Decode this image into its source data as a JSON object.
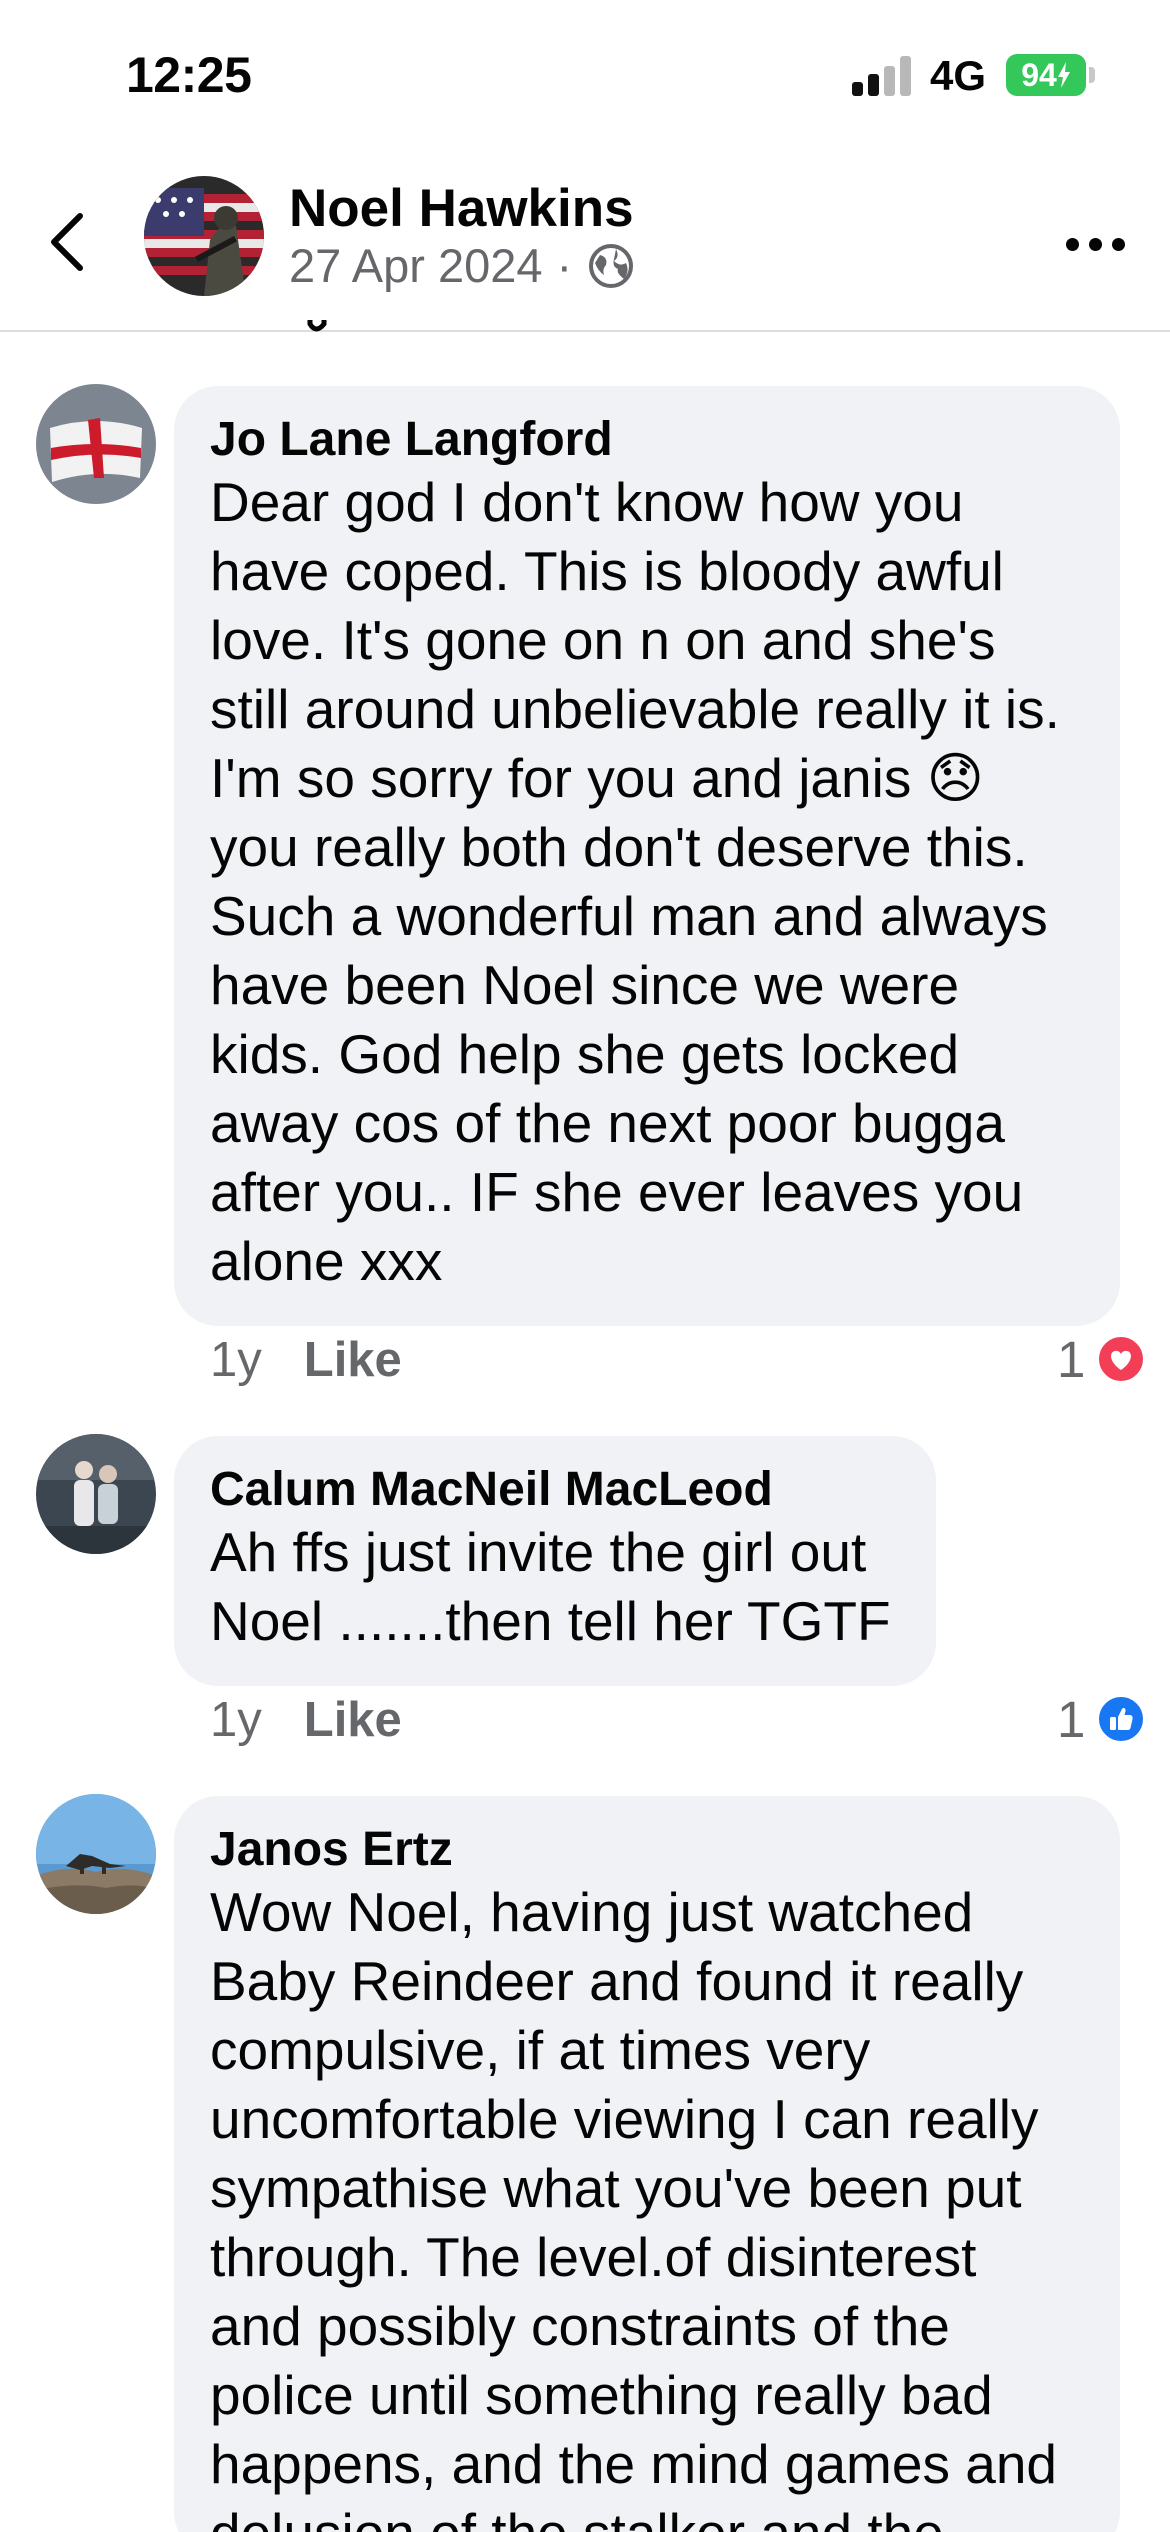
{
  "status_bar": {
    "time": "12:25",
    "network": "4G",
    "battery": "94",
    "battery_color": "#34c759"
  },
  "post_header": {
    "author": "Noel Hawkins",
    "date": "27 Apr 2024",
    "separator": "·",
    "back_icon": "chevron-left-icon",
    "privacy_icon": "globe-icon",
    "more_icon": "more-horizontal-icon"
  },
  "comments": [
    {
      "name": "Jo Lane Langford",
      "lines": [
        "Dear god I don't know how you",
        "have coped. This is bloody awful",
        "love. It's gone on n on and she's",
        "still around unbelievable really it is.",
        "I'm so sorry for you and janis 😞",
        "you really both don't deserve this.",
        "Such a wonderful man and always",
        "have been Noel since we were",
        "kids. God help she gets locked",
        "away cos of the next poor bugga",
        "after you.. IF she ever leaves you",
        "alone xxx"
      ],
      "time": "1y",
      "like_label": "Like",
      "reaction_count": "1",
      "reaction": "love-reaction-icon",
      "reaction_color": "#f33e58",
      "avatar_icon": "england-flag-avatar"
    },
    {
      "name": "Calum MacNeil MacLeod",
      "lines": [
        "Ah ffs just invite the girl out",
        "Noel .......then tell her TGTF"
      ],
      "time": "1y",
      "like_label": "Like",
      "reaction_count": "1",
      "reaction": "like-reaction-icon",
      "reaction_color": "#1877f2",
      "avatar_icon": "couple-photo-avatar"
    },
    {
      "name": "Janos Ertz",
      "lines": [
        "Wow Noel, having just watched",
        "Baby Reindeer and found it really",
        "compulsive, if at times very",
        "uncomfortable viewing I can really",
        "sympathise what you've been put",
        "through. The level.of disinterest",
        "and possibly constraints of the",
        "police until something really bad",
        "happens, and the mind games and",
        "delusion of the stalker and the"
      ],
      "avatar_icon": "lizard-photo-avatar"
    }
  ]
}
